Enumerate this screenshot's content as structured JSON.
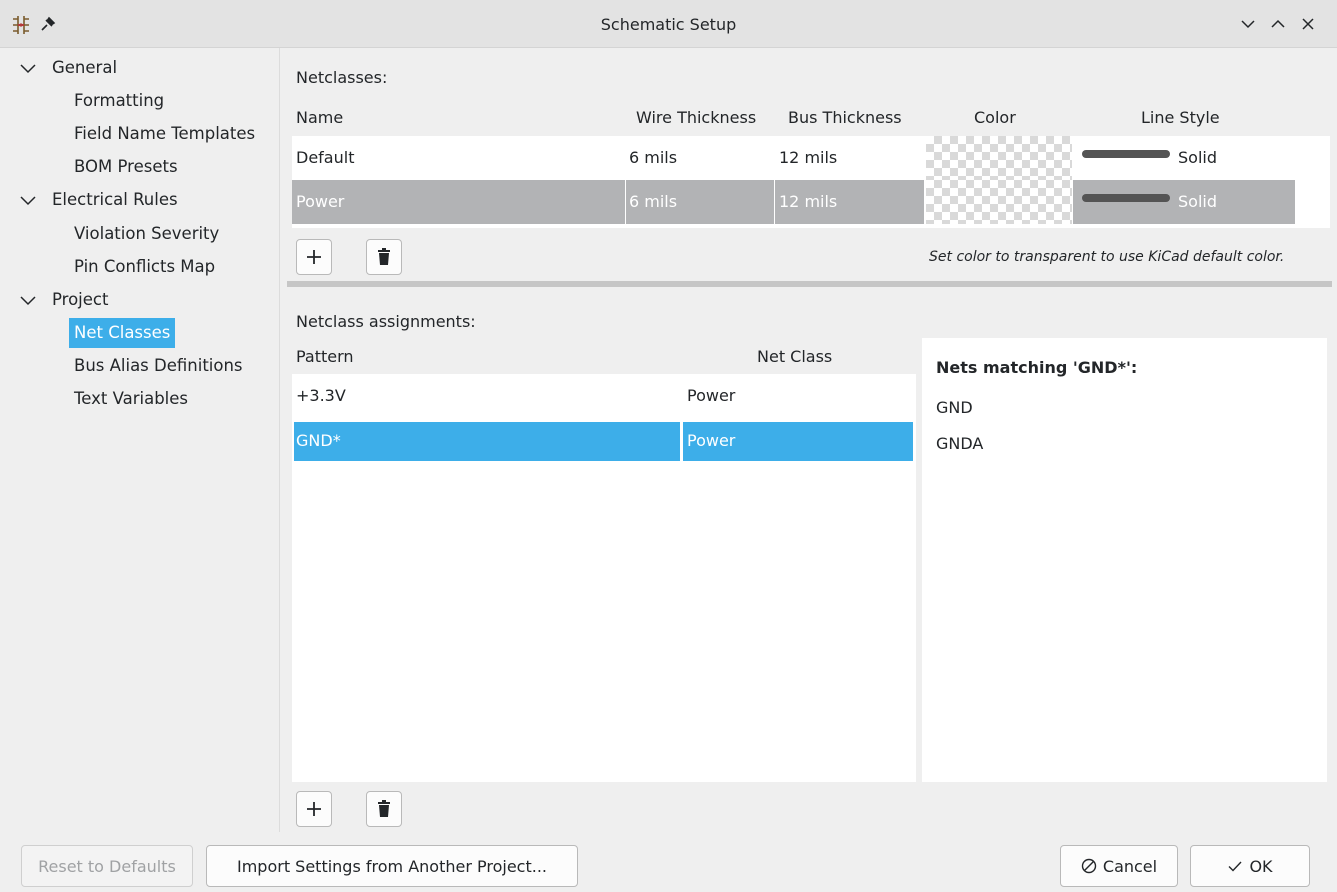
{
  "window": {
    "title": "Schematic Setup"
  },
  "sidebar": {
    "groups": [
      {
        "label": "General",
        "items": [
          "Formatting",
          "Field Name Templates",
          "BOM Presets"
        ]
      },
      {
        "label": "Electrical Rules",
        "items": [
          "Violation Severity",
          "Pin Conflicts Map"
        ]
      },
      {
        "label": "Project",
        "items": [
          "Net Classes",
          "Bus Alias Definitions",
          "Text Variables"
        ]
      }
    ],
    "selected": "Net Classes"
  },
  "netclasses": {
    "label": "Netclasses:",
    "columns": [
      "Name",
      "Wire Thickness",
      "Bus Thickness",
      "Color",
      "Line Style"
    ],
    "rows": [
      {
        "name": "Default",
        "wire": "6 mils",
        "bus": "12 mils",
        "color": "transparent",
        "line_style": "Solid"
      },
      {
        "name": "Power",
        "wire": "6 mils",
        "bus": "12 mils",
        "color": "transparent",
        "line_style": "Solid"
      }
    ],
    "hint": "Set color to transparent to use KiCad default color."
  },
  "assignments": {
    "label": "Netclass assignments:",
    "columns": [
      "Pattern",
      "Net Class"
    ],
    "rows": [
      {
        "pattern": "+3.3V",
        "netclass": "Power"
      },
      {
        "pattern": "GND*",
        "netclass": "Power"
      }
    ]
  },
  "nets_matching": {
    "title": "Nets matching 'GND*':",
    "items": [
      "GND",
      "GNDA"
    ]
  },
  "footer": {
    "reset_label": "Reset to Defaults",
    "import_label": "Import Settings from Another Project...",
    "cancel_label": "Cancel",
    "ok_label": "OK"
  },
  "colors": {
    "selection": "#3daee9",
    "inactive_selection": "#b2b3b5",
    "line_style": "#545454"
  }
}
